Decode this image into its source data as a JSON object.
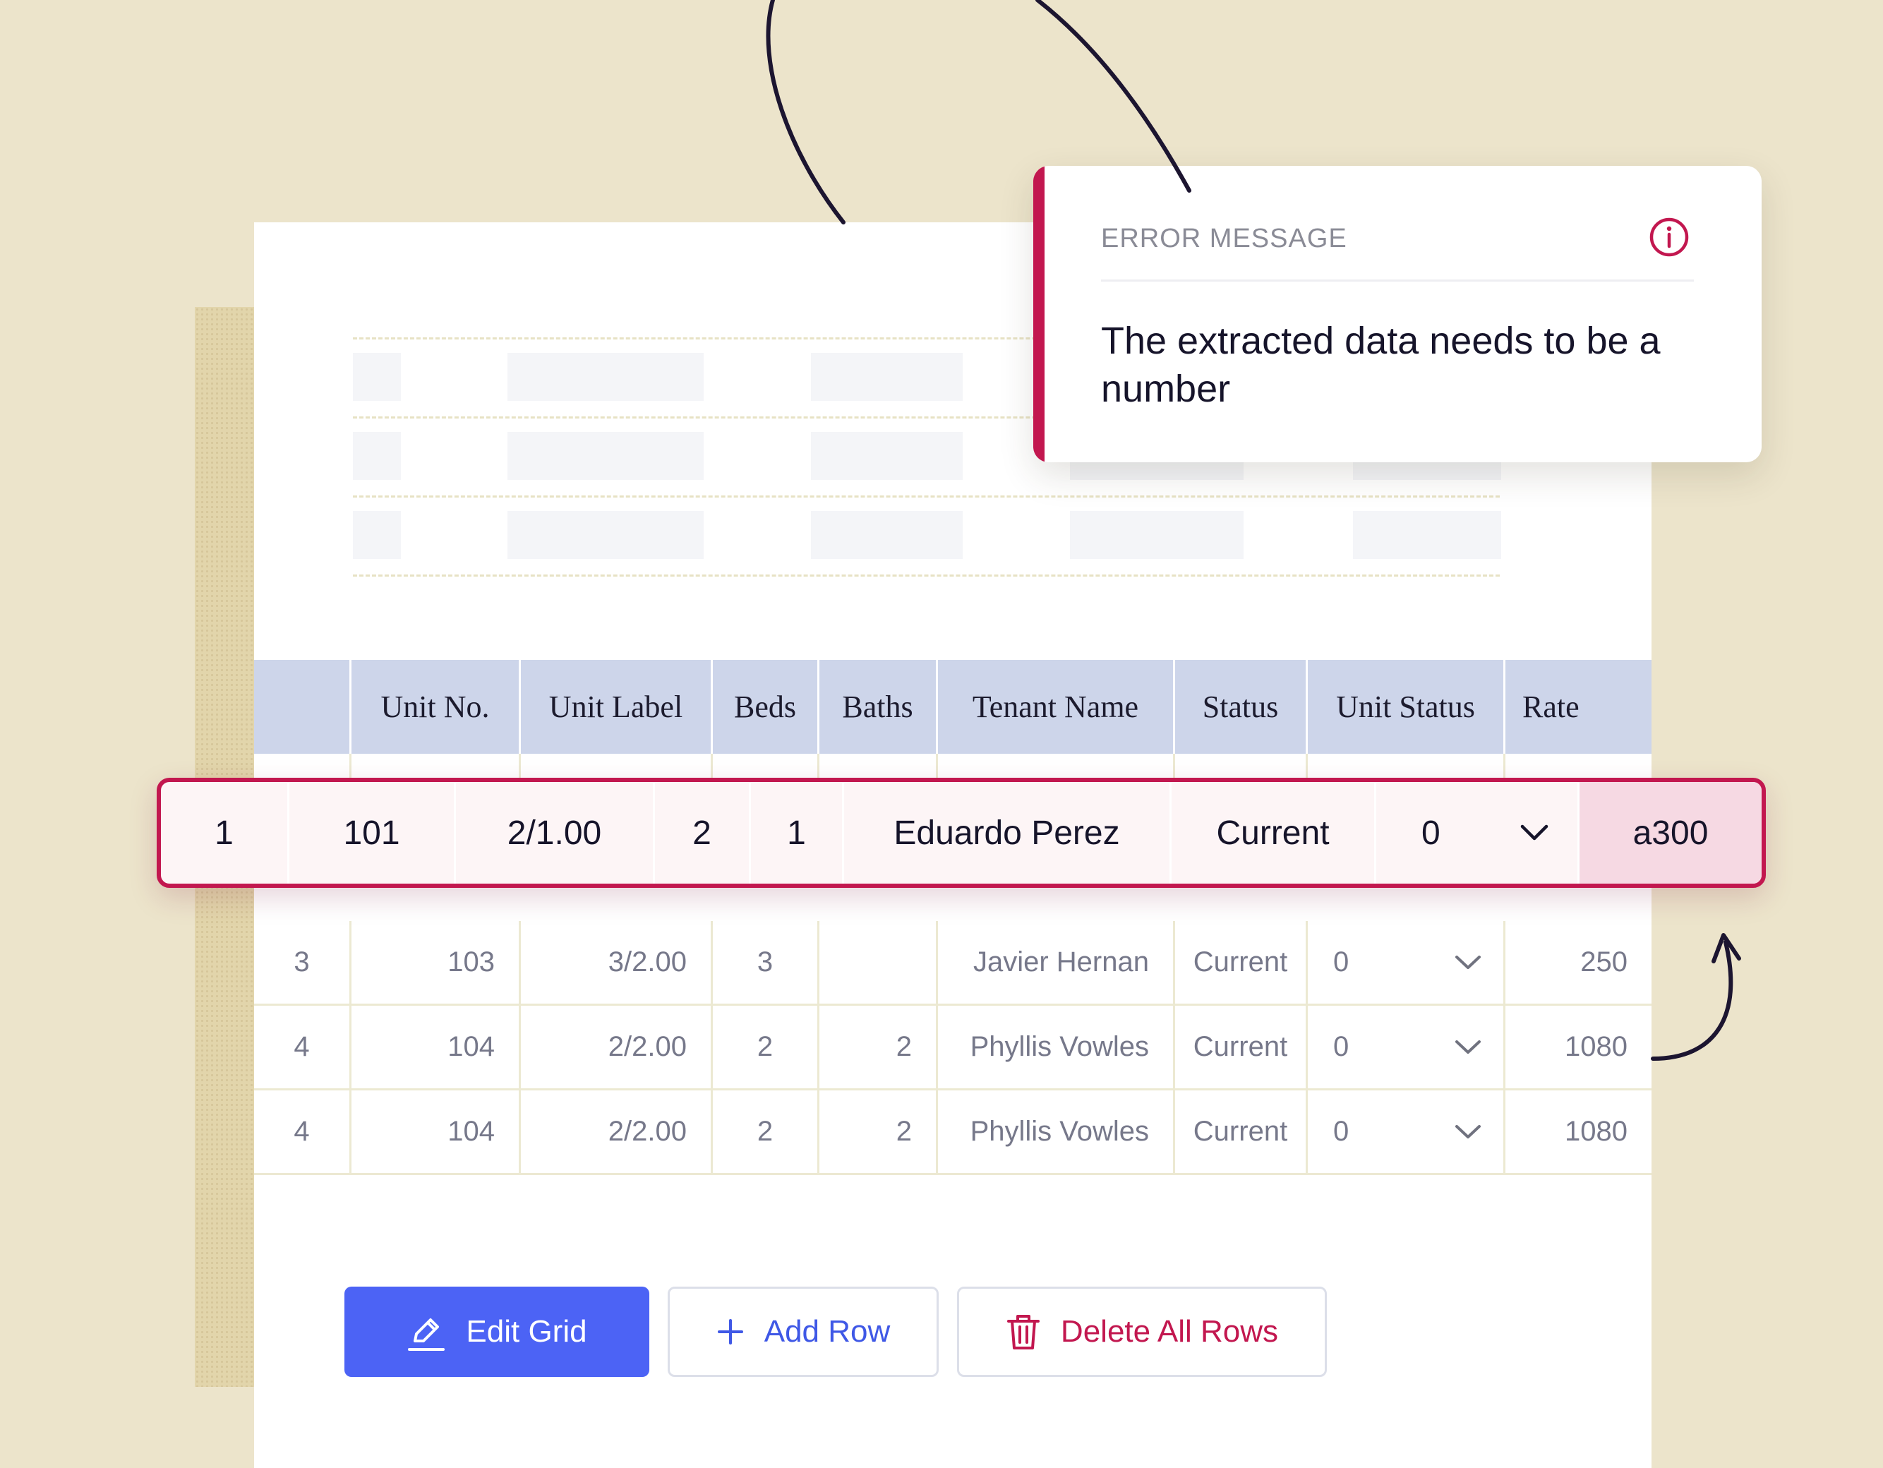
{
  "colors": {
    "background": "#ece4cb",
    "error_accent": "#c2174f",
    "primary_button": "#4c63f5",
    "header_row": "#cdd5ea",
    "error_cell": "#f6d9e3"
  },
  "error_popup": {
    "title": "ERROR MESSAGE",
    "icon": "info-icon",
    "message": "The extracted data needs to be a number"
  },
  "table": {
    "headers": [
      "",
      "Unit No.",
      "Unit Label",
      "Beds",
      "Baths",
      "Tenant Name",
      "Status",
      "Unit Status",
      "Rate"
    ],
    "highlighted_row": {
      "cells": [
        "1",
        "101",
        "2/1.00",
        "2",
        "1",
        "Eduardo Perez",
        "Current",
        "0",
        "a300"
      ],
      "unit_status_icon": "chevron-down-icon"
    },
    "rows": [
      [
        "3",
        "103",
        "3/2.00",
        "3",
        "",
        "Javier Hernan",
        "Current",
        "0",
        "250"
      ],
      [
        "4",
        "104",
        "2/2.00",
        "2",
        "2",
        "Phyllis Vowles",
        "Current",
        "0",
        "1080"
      ],
      [
        "4",
        "104",
        "2/2.00",
        "2",
        "2",
        "Phyllis Vowles",
        "Current",
        "0",
        "1080"
      ]
    ]
  },
  "buttons": {
    "edit_grid": {
      "label": "Edit Grid",
      "icon": "pencil-icon"
    },
    "add_row": {
      "label": "Add Row",
      "icon": "plus-icon"
    },
    "delete_all_rows": {
      "label": "Delete All Rows",
      "icon": "trash-icon"
    }
  }
}
